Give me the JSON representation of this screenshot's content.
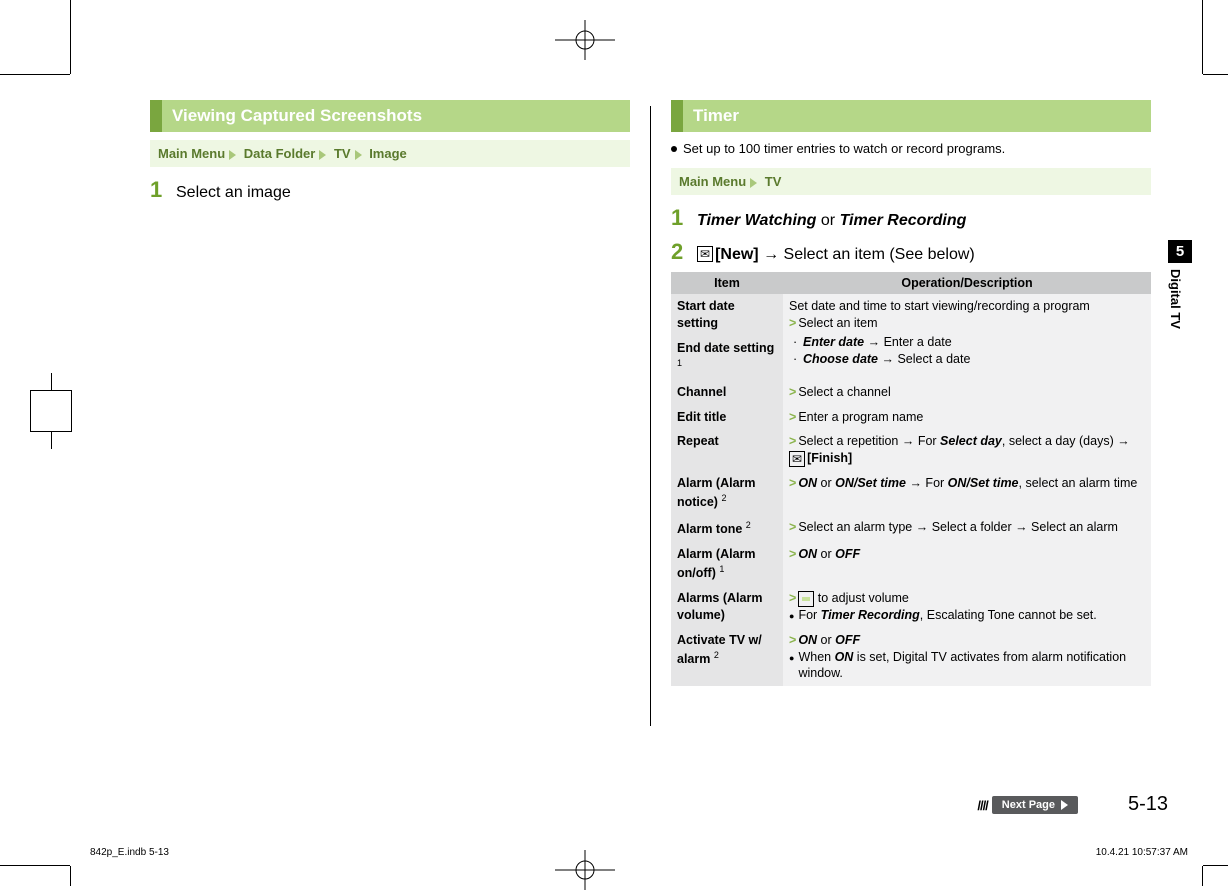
{
  "left": {
    "title": "Viewing Captured Screenshots",
    "breadcrumb": [
      "Main Menu",
      "Data Folder",
      "TV",
      "Image"
    ],
    "steps": [
      {
        "num": "1",
        "text": "Select an image"
      }
    ]
  },
  "right": {
    "title": "Timer",
    "note": "Set up to 100 timer entries to watch or record programs.",
    "breadcrumb": [
      "Main Menu",
      "TV"
    ],
    "steps": [
      {
        "num": "1",
        "html": "timer_step1"
      },
      {
        "num": "2",
        "html": "timer_step2"
      }
    ],
    "step1_a": "Timer Watching",
    "step1_or": " or ",
    "step1_b": "Timer Recording",
    "step2_new": "[New]",
    "step2_rest": " → Select an item (See below)",
    "table_headers": [
      "Item",
      "Operation/Description"
    ],
    "rows": [
      {
        "item": "Start date setting",
        "rowspan_with_next": true,
        "desc_lead": "Set date and time to start viewing/recording a program",
        "desc_gt": "Select an item",
        "desc_sub": [
          {
            "b": "Enter date",
            "rest": " → Enter a date"
          },
          {
            "b": "Choose date",
            "rest": " → Select a date"
          }
        ]
      },
      {
        "item": "End date setting",
        "sup": "1"
      },
      {
        "item": "Channel",
        "desc_gt": "Select a channel"
      },
      {
        "item": "Edit title",
        "desc_gt": "Enter a program name"
      },
      {
        "item": "Repeat",
        "desc_gt_html": "repeat"
      },
      {
        "item": "Alarm (Alarm notice)",
        "sup": "2",
        "desc_gt_html": "alarm_notice"
      },
      {
        "item": "Alarm tone",
        "sup": "2",
        "desc_gt": "Select an alarm type → Select a folder → Select an alarm"
      },
      {
        "item": "Alarm (Alarm on/off)",
        "sup": "1",
        "desc_gt_html": "on_off"
      },
      {
        "item": "Alarms (Alarm volume)",
        "desc_gt_html": "volume",
        "desc_bullet_html": "volume_bullet"
      },
      {
        "item": "Activate TV w/ alarm",
        "sup": "2",
        "desc_gt_html": "on_off",
        "desc_bullet_html": "activate_bullet"
      }
    ],
    "strings": {
      "repeat_a": "Select a repetition → For ",
      "repeat_b": "Select day",
      "repeat_c": ", select a day (days) → ",
      "repeat_d": "[Finish]",
      "alarm_a": "ON",
      "alarm_or": " or ",
      "alarm_b": "ON/Set time",
      "alarm_c": " → For ",
      "alarm_d": "ON/Set time",
      "alarm_e": ", select an alarm time",
      "on": "ON",
      "off": "OFF",
      "vol_a": " to adjust volume",
      "vol_b1": "For ",
      "vol_b2": "Timer Recording",
      "vol_b3": ", Escalating Tone cannot be set.",
      "act_b1": "When ",
      "act_b2": "ON",
      "act_b3": " is set, Digital TV activates from alarm notification window."
    }
  },
  "side": {
    "chapter": "5",
    "label": "Digital TV"
  },
  "page_number": "5-13",
  "next_page": "Next Page",
  "footer_left": "842p_E.indb   5-13",
  "footer_right": "10.4.21   10:57:37 AM"
}
